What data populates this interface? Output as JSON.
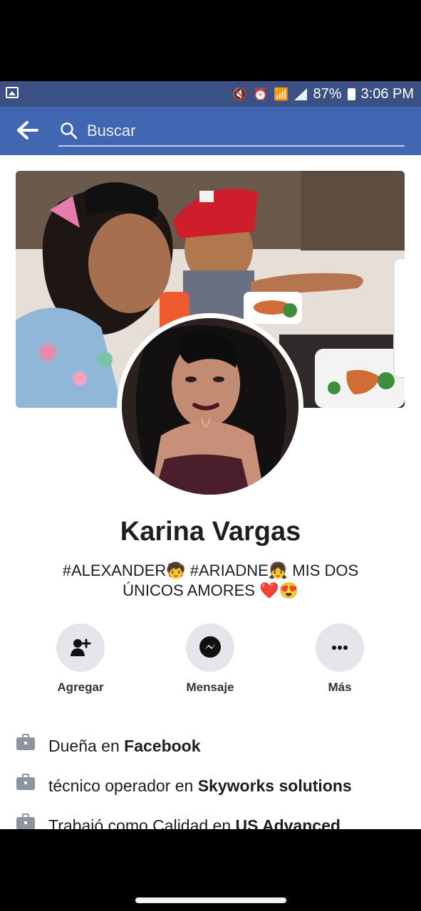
{
  "status_bar": {
    "battery": "87%",
    "time": "3:06 PM"
  },
  "search": {
    "placeholder": "Buscar"
  },
  "profile": {
    "name": "Karina Vargas",
    "bio_line1": "#ALEXANDER🧒 #ARIADNE👧 MIS DOS",
    "bio_line2": "ÚNICOS AMORES ❤️😍"
  },
  "actions": [
    {
      "label": "Agregar",
      "icon": "add-user-icon"
    },
    {
      "label": "Mensaje",
      "icon": "messenger-icon"
    },
    {
      "label": "Más",
      "icon": "more-icon"
    }
  ],
  "info": [
    {
      "prefix": "Dueña en",
      "highlight": "Facebook"
    },
    {
      "prefix": "técnico operador en",
      "highlight": "Skyworks solutions"
    },
    {
      "prefix": "Trabajó como Calidad en",
      "highlight": "US Advanced"
    }
  ],
  "colors": {
    "accent": "#4267b2",
    "status_bar": "#3b5183"
  }
}
